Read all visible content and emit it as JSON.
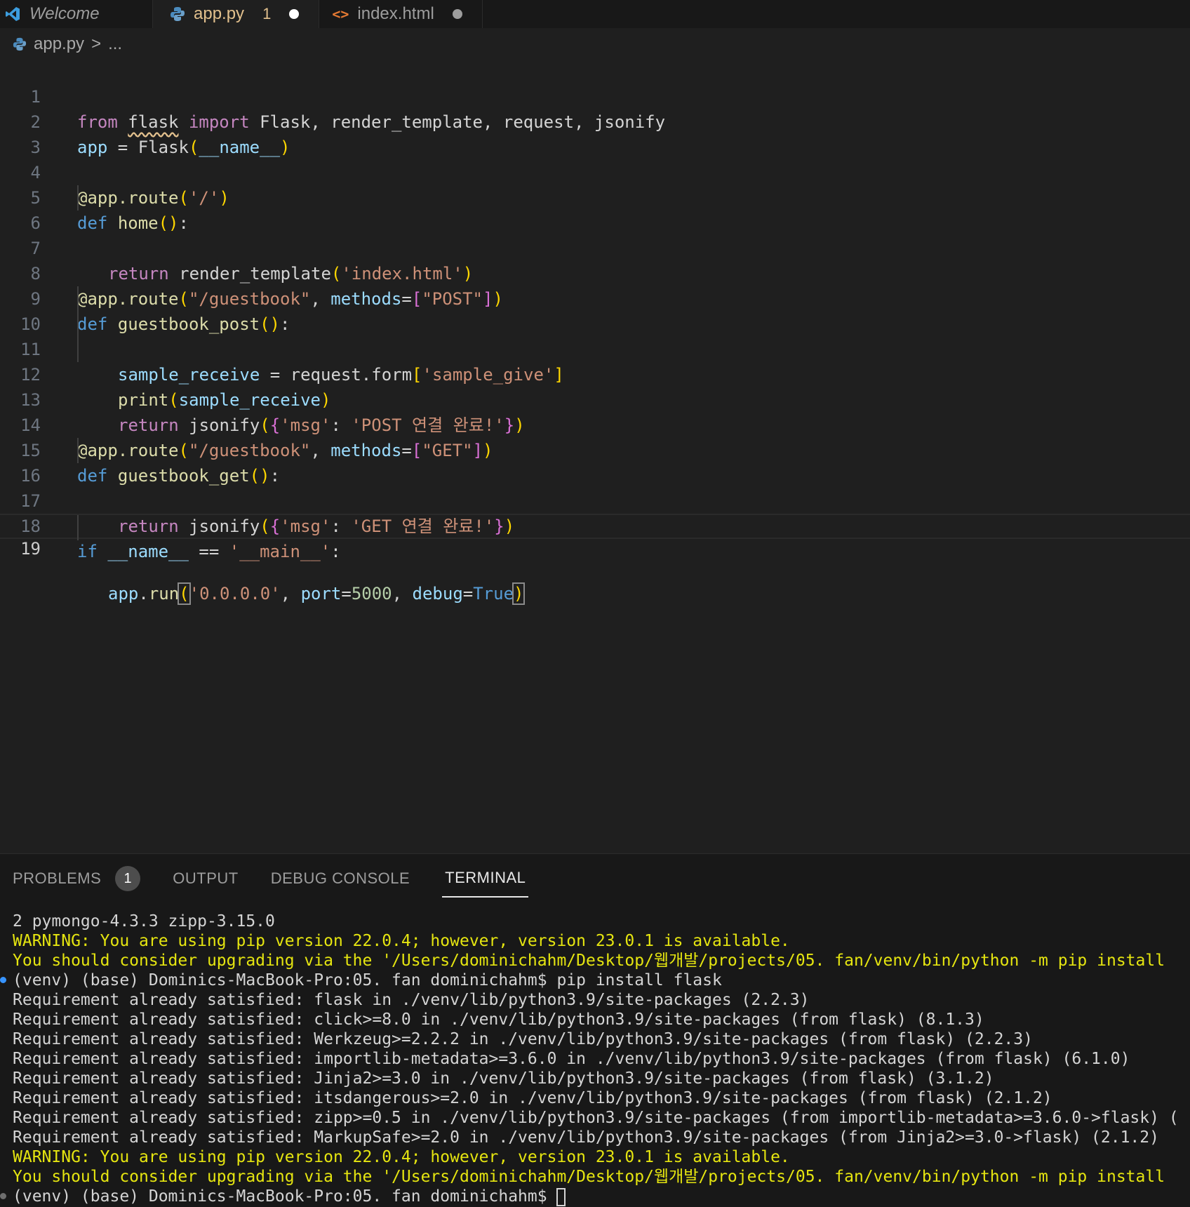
{
  "tabs": [
    {
      "label": "Welcome",
      "icon": "vscode-icon"
    },
    {
      "label": "app.py",
      "badge": "1",
      "modified": true,
      "icon": "python-icon"
    },
    {
      "label": "index.html",
      "modified": true,
      "icon": "html-icon"
    }
  ],
  "breadcrumb": {
    "file": "app.py",
    "sep": ">",
    "rest": "..."
  },
  "editor": {
    "line_numbers": [
      "1",
      "2",
      "3",
      "4",
      "5",
      "6",
      "7",
      "8",
      "9",
      "10",
      "11",
      "12",
      "13",
      "14",
      "15",
      "16",
      "17",
      "18",
      "19"
    ],
    "current_line": "19",
    "code": {
      "l1": {
        "from": "from",
        "mod": "flask",
        "import": "import",
        "rest": " Flask, render_template, request, jsonify"
      },
      "l2": {
        "a": "app",
        "b": " = ",
        "c": "Flask",
        "d": "(",
        "e": "__name__",
        "f": ")"
      },
      "l4": {
        "a": "@app.route",
        "b": "(",
        "c": "'/'",
        "d": ")"
      },
      "l5": {
        "a": "def",
        "b": " ",
        "c": "home",
        "d": "()",
        "e": ":"
      },
      "l6": {
        "a": "return",
        "b": " render_template",
        "c": "(",
        "d": "'index.html'",
        "e": ")"
      },
      "l8": {
        "a": "@app.route",
        "b": "(",
        "c": "\"/guestbook\"",
        "d": ", ",
        "e": "methods",
        "f": "=",
        "g": "[",
        "h": "\"POST\"",
        "i": "]",
        "j": ")"
      },
      "l9": {
        "a": "def",
        "b": " ",
        "c": "guestbook_post",
        "d": "()",
        "e": ":"
      },
      "l10": {
        "a": "sample_receive",
        "b": " = request.form",
        "c": "[",
        "d": "'sample_give'",
        "e": "]"
      },
      "l11": {
        "a": "print",
        "b": "(",
        "c": "sample_receive",
        "d": ")"
      },
      "l12": {
        "a": "return",
        "b": " jsonify",
        "c": "(",
        "d": "{",
        "e": "'msg'",
        "f": ": ",
        "g": "'POST 연결 완료!'",
        "h": "}",
        "i": ")"
      },
      "l14": {
        "a": "@app.route",
        "b": "(",
        "c": "\"/guestbook\"",
        "d": ", ",
        "e": "methods",
        "f": "=",
        "g": "[",
        "h": "\"GET\"",
        "i": "]",
        "j": ")"
      },
      "l15": {
        "a": "def",
        "b": " ",
        "c": "guestbook_get",
        "d": "()",
        "e": ":"
      },
      "l16": {
        "a": "return",
        "b": " jsonify",
        "c": "(",
        "d": "{",
        "e": "'msg'",
        "f": ": ",
        "g": "'GET 연결 완료!'",
        "h": "}",
        "i": ")"
      },
      "l18": {
        "a": "if",
        "b": " ",
        "c": "__name__",
        "d": " == ",
        "e": "'__main__'",
        "f": ":"
      },
      "l19": {
        "a": "app",
        "b": ".",
        "c": "run",
        "d": "(",
        "e": "'0.0.0.0'",
        "f": ", ",
        "g": "port",
        "h": "=",
        "i": "5000",
        "j": ", ",
        "k": "debug",
        "l": "=",
        "m": "True",
        "n": ")"
      }
    }
  },
  "panel": {
    "tabs": [
      {
        "label": "PROBLEMS",
        "badge": "1"
      },
      {
        "label": "OUTPUT"
      },
      {
        "label": "DEBUG CONSOLE"
      },
      {
        "label": "TERMINAL",
        "active": true
      }
    ]
  },
  "terminal": {
    "lines": [
      "2 pymongo-4.3.3 zipp-3.15.0",
      "WARNING: You are using pip version 22.0.4; however, version 23.0.1 is available.",
      "You should consider upgrading via the '/Users/dominichahm/Desktop/웹개발/projects/05. fan/venv/bin/python -m pip install",
      "(venv) (base) Dominics-MacBook-Pro:05. fan dominichahm$ pip install flask",
      "Requirement already satisfied: flask in ./venv/lib/python3.9/site-packages (2.2.3)",
      "Requirement already satisfied: click>=8.0 in ./venv/lib/python3.9/site-packages (from flask) (8.1.3)",
      "Requirement already satisfied: Werkzeug>=2.2.2 in ./venv/lib/python3.9/site-packages (from flask) (2.2.3)",
      "Requirement already satisfied: importlib-metadata>=3.6.0 in ./venv/lib/python3.9/site-packages (from flask) (6.1.0)",
      "Requirement already satisfied: Jinja2>=3.0 in ./venv/lib/python3.9/site-packages (from flask) (3.1.2)",
      "Requirement already satisfied: itsdangerous>=2.0 in ./venv/lib/python3.9/site-packages (from flask) (2.1.2)",
      "Requirement already satisfied: zipp>=0.5 in ./venv/lib/python3.9/site-packages (from importlib-metadata>=3.6.0->flask) (",
      "Requirement already satisfied: MarkupSafe>=2.0 in ./venv/lib/python3.9/site-packages (from Jinja2>=3.0->flask) (2.1.2)",
      "WARNING: You are using pip version 22.0.4; however, version 23.0.1 is available.",
      "You should consider upgrading via the '/Users/dominichahm/Desktop/웹개발/projects/05. fan/venv/bin/python -m pip install",
      "(venv) (base) Dominics-MacBook-Pro:05. fan dominichahm$ "
    ]
  },
  "colors": {
    "keyword": "#c586c0",
    "storage": "#569cd6",
    "function": "#dcdcaa",
    "variable": "#9cdcfe",
    "string": "#ce9178",
    "warning": "#e5e510"
  }
}
